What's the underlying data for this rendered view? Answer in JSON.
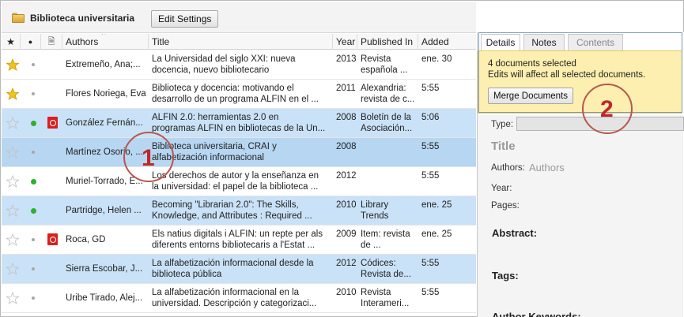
{
  "toolbar": {
    "library_title": "Biblioteca universitaria",
    "edit_settings_label": "Edit Settings"
  },
  "table": {
    "columns": {
      "star": "★",
      "dot": "●",
      "attachment": "🗎",
      "authors": "Authors",
      "title": "Title",
      "year": "Year",
      "published_in": "Published In",
      "added": "Added"
    },
    "rows": [
      {
        "starred": true,
        "status": "grey",
        "pdf": false,
        "selected": false,
        "authors": "Extremeño, Ana;...",
        "title1": "La Universidad del siglo XXI: nueva",
        "title2": "docencia, nuevo bibliotecario",
        "year": "2013",
        "pub1": "Revista",
        "pub2": "española ...",
        "added": "ene. 30"
      },
      {
        "starred": true,
        "status": "grey",
        "pdf": false,
        "selected": false,
        "authors": "Flores Noriega, Eva",
        "title1": "Biblioteca y docencia: motivando el",
        "title2": "desarrollo de un programa ALFIN en el ...",
        "year": "2011",
        "pub1": "Alexandria:",
        "pub2": "revista de c...",
        "added": "5:55"
      },
      {
        "starred": false,
        "status": "green",
        "pdf": true,
        "selected": true,
        "authors": "González Fernán...",
        "title1": "ALFIN 2.0: herramientas 2.0 en",
        "title2": "programas ALFIN en bibliotecas de la Un...",
        "year": "2008",
        "pub1": "Boletín de la",
        "pub2": "Asociación...",
        "added": "5:06"
      },
      {
        "starred": false,
        "status": "grey",
        "pdf": false,
        "selected": true,
        "authors": "Martínez Osorio, ...",
        "title1": "Biblioteca universitaria, CRAI y",
        "title2": "alfabetización informacional",
        "year": "2008",
        "pub1": "",
        "pub2": "",
        "added": "5:55"
      },
      {
        "starred": false,
        "status": "green",
        "pdf": false,
        "selected": false,
        "authors": "Muriel-Torrado, E...",
        "title1": "Los derechos de autor y la enseñanza en",
        "title2": "la universidad: el papel de la biblioteca ...",
        "year": "2012",
        "pub1": "",
        "pub2": "",
        "added": "5:55"
      },
      {
        "starred": false,
        "status": "green",
        "pdf": false,
        "selected": true,
        "authors": "Partridge, Helen ...",
        "title1": "Becoming \"Librarian 2.0\": The Skills,",
        "title2": "Knowledge, and Attributes : Required ...",
        "year": "2010",
        "pub1": "Library",
        "pub2": "Trends",
        "added": "ene. 25"
      },
      {
        "starred": false,
        "status": "grey",
        "pdf": true,
        "selected": false,
        "authors": "Roca, GD",
        "title1": "Els natius digitals i ALFIN: un repte per als",
        "title2": "diferents entorns bibliotecaris a l'Estat ...",
        "year": "2009",
        "pub1": "Item: revista",
        "pub2": "de ...",
        "added": "ene. 25"
      },
      {
        "starred": false,
        "status": "grey",
        "pdf": false,
        "selected": true,
        "authors": "Sierra Escobar, J...",
        "title1": "La alfabetización informacional desde la",
        "title2": "biblioteca pública",
        "year": "2012",
        "pub1": "Códices:",
        "pub2": "Revista de...",
        "added": "5:55"
      },
      {
        "starred": false,
        "status": "grey",
        "pdf": false,
        "selected": false,
        "authors": "Uribe Tirado, Alej...",
        "title1": "La alfabetización informacional en la",
        "title2": "universidad. Descripción y categorizaci...",
        "year": "2010",
        "pub1": "Revista",
        "pub2": "Interameri...",
        "added": "5:55"
      }
    ]
  },
  "right_pane": {
    "tabs": [
      "Details",
      "Notes",
      "Contents"
    ],
    "selected_count_text": "4 documents selected",
    "edits_text": "Edits will affect all selected documents.",
    "merge_label": "Merge Documents",
    "type_label": "Type:",
    "title_placeholder": "Title",
    "authors_label": "Authors:",
    "authors_placeholder": "Authors",
    "year_label": "Year:",
    "pages_label": "Pages:",
    "abstract_label": "Abstract:",
    "tags_label": "Tags:",
    "author_keywords_label": "Author Keywords:"
  },
  "annotations": [
    "1",
    "2"
  ],
  "colors": {
    "selection": "#c9e2f7",
    "info_box": "#fcefb0",
    "annotation": "#c02828"
  }
}
